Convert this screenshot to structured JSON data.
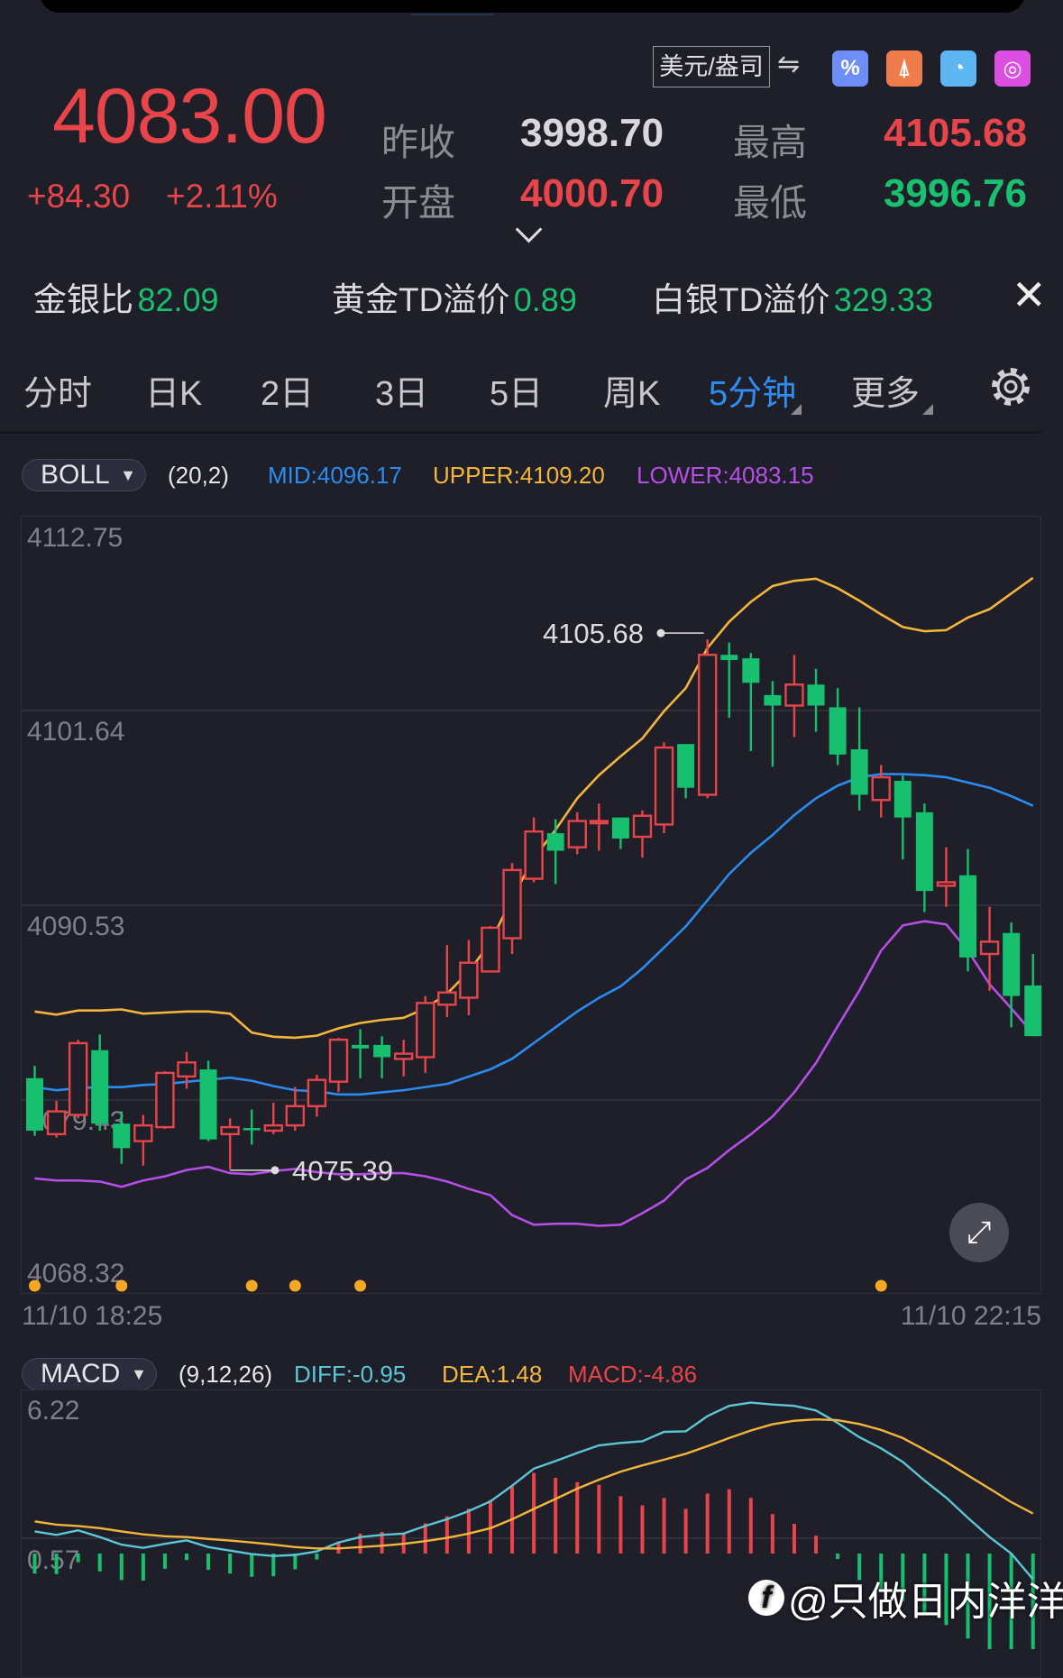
{
  "header": {
    "price": "4083.00",
    "change": "+84.30",
    "change_pct": "+2.11%",
    "unit": "美元/盎司",
    "stats": [
      {
        "label": "昨收",
        "value": "3998.70",
        "color": "#d8d8dc"
      },
      {
        "label": "最高",
        "value": "4105.68",
        "color": "#e8454a"
      },
      {
        "label": "开盘",
        "value": "4000.70",
        "color": "#e8454a"
      },
      {
        "label": "最低",
        "value": "3996.76",
        "color": "#18c06f"
      }
    ],
    "tool_icons": [
      {
        "name": "percent-icon",
        "glyph": "%",
        "color": "#6d8ef6"
      },
      {
        "name": "lighthouse-icon",
        "glyph": "⍋",
        "color": "#f07b4b"
      },
      {
        "name": "pie-chart-icon",
        "glyph": "◔",
        "color": "#5db6f2"
      },
      {
        "name": "target-icon",
        "glyph": "◎",
        "color": "#dd4fe3"
      }
    ]
  },
  "ratios": [
    {
      "label": "金银比",
      "value": "82.09"
    },
    {
      "label": "黄金TD溢价",
      "value": "0.89"
    },
    {
      "label": "白银TD溢价",
      "value": "329.33"
    }
  ],
  "tabs": [
    "分时",
    "日K",
    "2日",
    "3日",
    "5日",
    "周K",
    "5分钟",
    "更多"
  ],
  "active_tab": "5分钟",
  "boll": {
    "name": "BOLL",
    "params": "(20,2)",
    "mid": "MID:4096.17",
    "upper": "UPPER:4109.20",
    "lower": "LOWER:4083.15"
  },
  "macd": {
    "name": "MACD",
    "params": "(9,12,26)",
    "diff": "DIFF:-0.95",
    "dea": "DEA:1.48",
    "macd": "MACD:-4.86"
  },
  "colors": {
    "up": "#e8454a",
    "down": "#16c06f",
    "mid": "#2a8cf0",
    "upper": "#f4b53d",
    "lower": "#b84ee8",
    "diff": "#5cc6d6",
    "dea": "#f4b53d",
    "marker": "#f7a823"
  },
  "chart_data": [
    {
      "type": "candlestick",
      "y_axis_labels": [
        "4112.75",
        "4101.64",
        "4090.53",
        "4079.43",
        "4068.32"
      ],
      "ylim": [
        4068.32,
        4112.75
      ],
      "x_labels": [
        "11/10 18:25",
        "11/10 22:15"
      ],
      "ohlc": [
        [
          4080.6,
          4081.3,
          4077.3,
          4077.6
        ],
        [
          4077.4,
          4079.3,
          4077.2,
          4078.7
        ],
        [
          4078.5,
          4082.8,
          4078.3,
          4082.6
        ],
        [
          4082.2,
          4083.1,
          4077.6,
          4078.0
        ],
        [
          4078.0,
          4078.7,
          4075.7,
          4076.6
        ],
        [
          4077.0,
          4078.5,
          4075.6,
          4077.9
        ],
        [
          4077.8,
          4081.0,
          4077.7,
          4080.9
        ],
        [
          4080.7,
          4082.1,
          4080.0,
          4081.5
        ],
        [
          4081.1,
          4081.6,
          4077.0,
          4077.1
        ],
        [
          4077.4,
          4078.3,
          4075.39,
          4077.8
        ],
        [
          4077.75,
          4078.8,
          4076.8,
          4077.7
        ],
        [
          4077.6,
          4079.2,
          4077.4,
          4077.9
        ],
        [
          4077.9,
          4080.1,
          4077.6,
          4079.0
        ],
        [
          4079.0,
          4080.8,
          4078.4,
          4080.5
        ],
        [
          4080.4,
          4082.9,
          4079.8,
          4082.8
        ],
        [
          4082.5,
          4083.4,
          4080.6,
          4082.3
        ],
        [
          4082.5,
          4083.0,
          4080.6,
          4081.8
        ],
        [
          4081.7,
          4082.8,
          4080.7,
          4082.0
        ],
        [
          4081.8,
          4085.3,
          4080.9,
          4084.9
        ],
        [
          4084.8,
          4088.2,
          4084.1,
          4085.5
        ],
        [
          4085.2,
          4088.5,
          4084.2,
          4087.2
        ],
        [
          4086.7,
          4089.3,
          4086.7,
          4089.2
        ],
        [
          4088.6,
          4092.9,
          4087.7,
          4092.5
        ],
        [
          4092.0,
          4095.5,
          4091.8,
          4094.7
        ],
        [
          4094.6,
          4095.4,
          4091.7,
          4093.6
        ],
        [
          4093.8,
          4095.8,
          4093.4,
          4095.3
        ],
        [
          4095.2,
          4096.3,
          4093.6,
          4095.3
        ],
        [
          4095.5,
          4095.5,
          4093.7,
          4094.3
        ],
        [
          4094.4,
          4095.9,
          4093.2,
          4095.6
        ],
        [
          4095.1,
          4099.8,
          4094.6,
          4099.5
        ],
        [
          4099.7,
          4099.7,
          4096.6,
          4097.2
        ],
        [
          4096.8,
          4105.68,
          4096.6,
          4104.8
        ],
        [
          4104.8,
          4105.5,
          4101.2,
          4104.5
        ],
        [
          4104.6,
          4104.9,
          4099.3,
          4103.2
        ],
        [
          4102.5,
          4103.3,
          4098.4,
          4101.9
        ],
        [
          4101.9,
          4104.8,
          4100.1,
          4103.1
        ],
        [
          4103.1,
          4104.0,
          4100.4,
          4101.9
        ],
        [
          4101.8,
          4102.9,
          4098.5,
          4099.1
        ],
        [
          4099.4,
          4101.8,
          4095.9,
          4096.8
        ],
        [
          4096.5,
          4098.5,
          4095.5,
          4097.8
        ],
        [
          4097.6,
          4097.9,
          4093.1,
          4095.5
        ],
        [
          4095.8,
          4096.3,
          4090.1,
          4091.3
        ],
        [
          4091.6,
          4093.8,
          4090.4,
          4091.8
        ],
        [
          4092.2,
          4093.7,
          4086.7,
          4087.5
        ],
        [
          4087.7,
          4090.4,
          4085.6,
          4088.4
        ],
        [
          4088.9,
          4089.5,
          4083.5,
          4085.3
        ],
        [
          4085.9,
          4087.7,
          4083.0,
          4083.0
        ]
      ],
      "upper": [
        4084.41,
        4084.23,
        4084.47,
        4084.47,
        4084.53,
        4084.29,
        4084.35,
        4084.41,
        4084.41,
        4084.29,
        4083.21,
        4082.97,
        4082.91,
        4083.03,
        4083.45,
        4083.75,
        4083.93,
        4084.05,
        4084.59,
        4085.43,
        4086.69,
        4088.37,
        4090.89,
        4093.18,
        4094.8,
        4096.6,
        4097.92,
        4099.0,
        4100.02,
        4101.58,
        4102.9,
        4105.19,
        4106.69,
        4107.83,
        4108.73,
        4109.03,
        4109.15,
        4108.61,
        4107.89,
        4107.11,
        4106.39,
        4106.15,
        4106.21,
        4106.93,
        4107.41,
        4108.31,
        4109.2
      ],
      "mid": [
        4080.09,
        4079.91,
        4080.03,
        4080.09,
        4080.09,
        4080.21,
        4080.27,
        4080.39,
        4080.51,
        4080.63,
        4080.45,
        4080.15,
        4079.91,
        4079.85,
        4079.67,
        4079.67,
        4079.79,
        4079.91,
        4080.09,
        4080.27,
        4080.69,
        4081.11,
        4081.71,
        4082.61,
        4083.51,
        4084.41,
        4085.19,
        4085.85,
        4086.87,
        4088.07,
        4089.27,
        4090.77,
        4092.27,
        4093.48,
        4094.5,
        4095.64,
        4096.6,
        4097.32,
        4097.8,
        4097.98,
        4097.98,
        4097.92,
        4097.8,
        4097.5,
        4097.2,
        4096.72,
        4096.17
      ],
      "lower": [
        4074.87,
        4074.75,
        4074.75,
        4074.69,
        4074.39,
        4074.75,
        4074.99,
        4075.35,
        4075.53,
        4075.17,
        4075.11,
        4075.29,
        4075.41,
        4075.23,
        4075.11,
        4075.11,
        4075.17,
        4075.17,
        4074.99,
        4074.69,
        4074.27,
        4073.91,
        4072.77,
        4072.22,
        4072.28,
        4072.28,
        4072.16,
        4072.22,
        4072.88,
        4073.6,
        4074.81,
        4075.47,
        4076.49,
        4077.39,
        4078.41,
        4079.79,
        4081.47,
        4083.57,
        4085.61,
        4087.89,
        4089.33,
        4089.57,
        4089.39,
        4087.89,
        4085.97,
        4084.59,
        4083.15
      ],
      "annotations": [
        {
          "label": "4105.68",
          "index": 31,
          "value": 4105.68
        },
        {
          "label": "4075.39",
          "index": 9,
          "value": 4075.39
        }
      ],
      "signal_markers": [
        0,
        4,
        10,
        12,
        15,
        39
      ]
    },
    {
      "type": "macd",
      "y_axis_labels": [
        "6.22",
        "0.57"
      ],
      "diff": [
        0.82,
        0.69,
        0.86,
        0.61,
        0.33,
        0.21,
        0.36,
        0.49,
        0.24,
        0.11,
        -0.02,
        -0.09,
        -0.05,
        0.08,
        0.41,
        0.61,
        0.69,
        0.74,
        1.02,
        1.27,
        1.57,
        1.93,
        2.51,
        3.14,
        3.42,
        3.72,
        4.0,
        4.09,
        4.15,
        4.5,
        4.52,
        5.08,
        5.46,
        5.58,
        5.51,
        5.46,
        5.29,
        4.83,
        4.3,
        3.89,
        3.39,
        2.7,
        2.07,
        1.32,
        0.61,
        0.0,
        -0.95
      ],
      "dea": [
        1.19,
        1.07,
        1.02,
        0.94,
        0.82,
        0.71,
        0.64,
        0.61,
        0.54,
        0.48,
        0.41,
        0.33,
        0.24,
        0.19,
        0.19,
        0.24,
        0.29,
        0.36,
        0.46,
        0.58,
        0.74,
        0.94,
        1.27,
        1.65,
        2.02,
        2.4,
        2.73,
        3.03,
        3.26,
        3.47,
        3.69,
        3.97,
        4.27,
        4.55,
        4.78,
        4.91,
        4.96,
        4.93,
        4.79,
        4.57,
        4.27,
        3.84,
        3.39,
        2.89,
        2.4,
        1.9,
        1.48
      ]
    }
  ],
  "watermark": "@只做日内洋洋"
}
